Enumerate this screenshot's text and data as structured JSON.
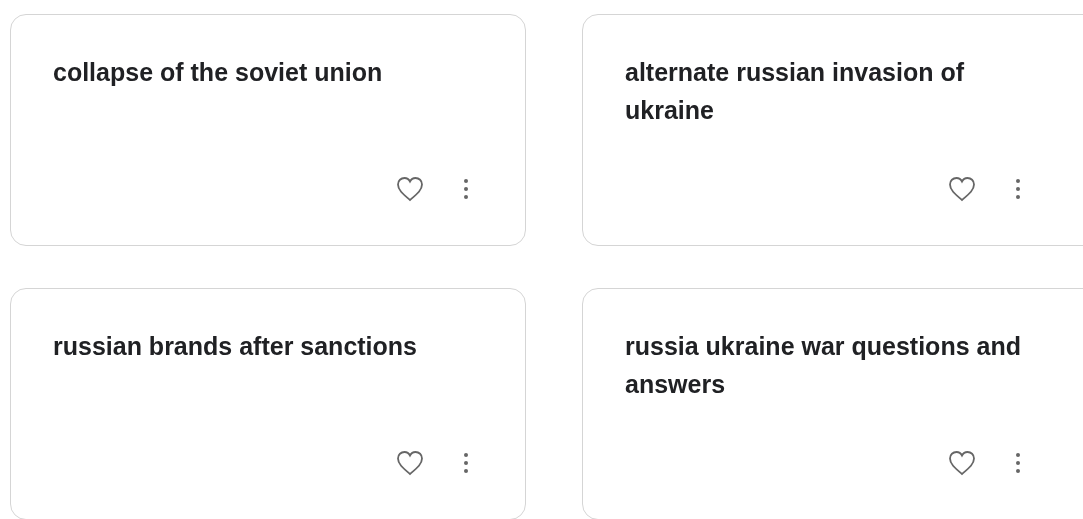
{
  "cards": [
    {
      "title": "collapse of the soviet union"
    },
    {
      "title": "alternate russian invasion of ukraine"
    },
    {
      "title": "russian brands after sanctions"
    },
    {
      "title": "russia ukraine war questions and answers"
    }
  ]
}
